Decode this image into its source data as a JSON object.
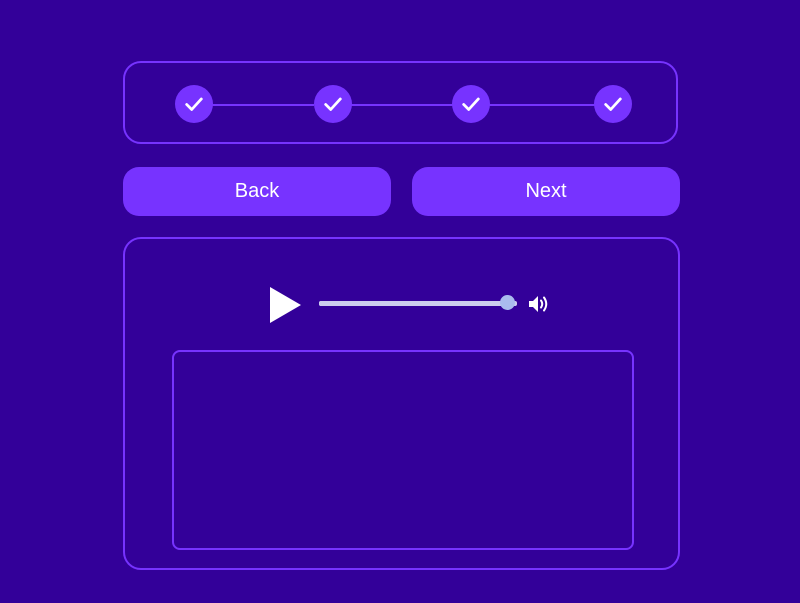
{
  "stepper": {
    "steps": [
      {
        "status": "completed",
        "icon": "check-icon"
      },
      {
        "status": "completed",
        "icon": "check-icon"
      },
      {
        "status": "completed",
        "icon": "check-icon"
      },
      {
        "status": "completed",
        "icon": "check-icon"
      }
    ]
  },
  "nav": {
    "back_label": "Back",
    "next_label": "Next"
  },
  "player": {
    "play_icon": "play-icon",
    "progress_fraction": 0.95,
    "volume_icon": "volume-icon"
  },
  "colors": {
    "background": "#330099",
    "accent": "#7733ff",
    "track": "#ccccee",
    "knob": "#aabbee",
    "text": "#ffffff"
  }
}
